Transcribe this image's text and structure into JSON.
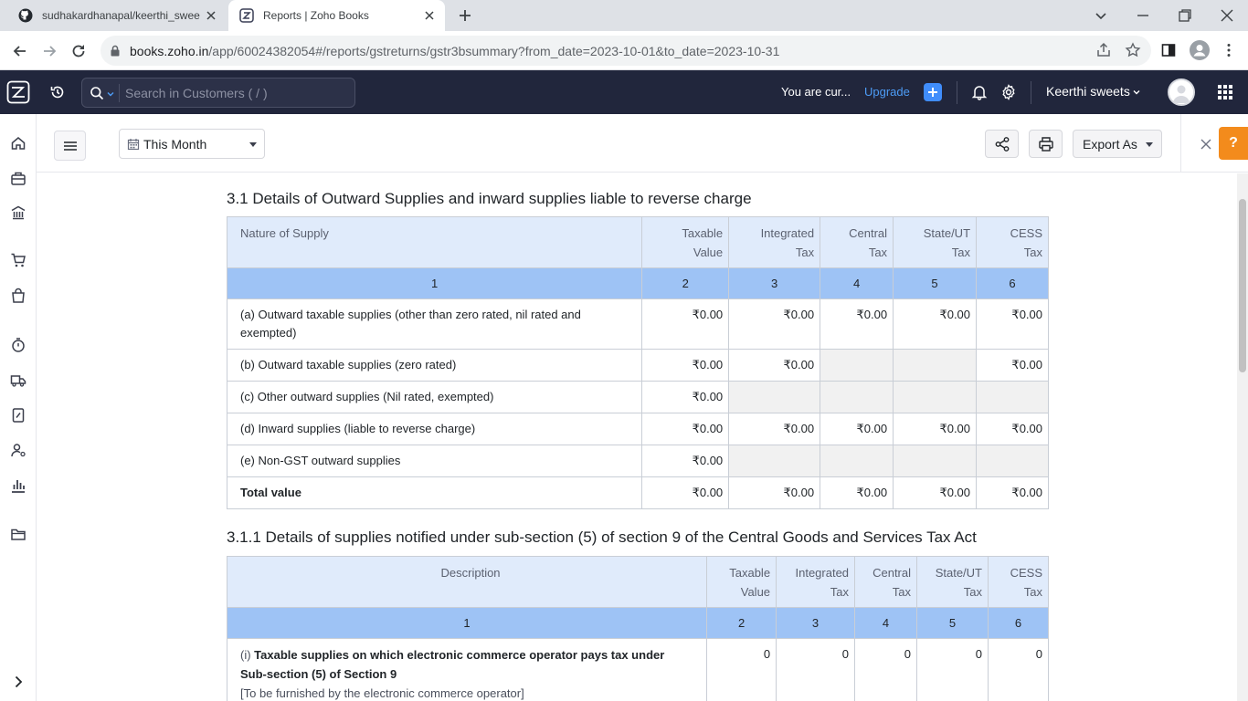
{
  "browser": {
    "tabs": [
      {
        "title": "sudhakardhanapal/keerthi_swee",
        "icon": "github-icon",
        "active": false
      },
      {
        "title": "Reports | Zoho Books",
        "icon": "zoho-books-icon",
        "active": true
      }
    ],
    "url_host": "books.zoho.in",
    "url_path": "/app/60024382054#/reports/gstreturns/gstr3bsummary?from_date=2023-10-01&to_date=2023-10-31"
  },
  "topbar": {
    "search_placeholder": "Search in Customers ( / )",
    "trial_text": "You are cur...",
    "upgrade_label": "Upgrade",
    "org_name": "Keerthi sweets"
  },
  "toolbar": {
    "period_label": "This Month",
    "export_label": "Export As",
    "help_label": "?"
  },
  "section1": {
    "title": "3.1 Details of Outward Supplies and inward supplies liable to reverse charge",
    "headers": [
      "Nature of Supply",
      "Taxable Value",
      "Integrated Tax",
      "Central Tax",
      "State/UT Tax",
      "CESS Tax"
    ],
    "header_lines": [
      [
        "Nature of Supply"
      ],
      [
        "Taxable",
        "Value"
      ],
      [
        "Integrated",
        "Tax"
      ],
      [
        "Central",
        "Tax"
      ],
      [
        "State/UT",
        "Tax"
      ],
      [
        "CESS",
        "Tax"
      ]
    ],
    "col_numbers": [
      "1",
      "2",
      "3",
      "4",
      "5",
      "6"
    ],
    "rows": [
      {
        "label": "(a) Outward taxable supplies (other than zero rated, nil rated and exempted)",
        "taxable": "₹0.00",
        "integrated": "₹0.00",
        "central": "₹0.00",
        "state": "₹0.00",
        "cess": "₹0.00"
      },
      {
        "label": "(b) Outward taxable supplies (zero rated)",
        "taxable": "₹0.00",
        "integrated": "₹0.00",
        "central": "",
        "state": "",
        "cess": "₹0.00"
      },
      {
        "label": "(c) Other outward supplies (Nil rated, exempted)",
        "taxable": "₹0.00",
        "integrated": "",
        "central": "",
        "state": "",
        "cess": ""
      },
      {
        "label": "(d) Inward supplies (liable to reverse charge)",
        "taxable": "₹0.00",
        "integrated": "₹0.00",
        "central": "₹0.00",
        "state": "₹0.00",
        "cess": "₹0.00"
      },
      {
        "label": "(e) Non-GST outward supplies",
        "taxable": "₹0.00",
        "integrated": "",
        "central": "",
        "state": "",
        "cess": ""
      }
    ],
    "total": {
      "label": "Total value",
      "taxable": "₹0.00",
      "integrated": "₹0.00",
      "central": "₹0.00",
      "state": "₹0.00",
      "cess": "₹0.00"
    }
  },
  "section2": {
    "title": "3.1.1 Details of supplies notified under sub-section (5) of section 9 of the Central Goods and Services Tax Act",
    "header_lines": [
      [
        "Description"
      ],
      [
        "Taxable",
        "Value"
      ],
      [
        "Integrated",
        "Tax"
      ],
      [
        "Central",
        "Tax"
      ],
      [
        "State/UT",
        "Tax"
      ],
      [
        "CESS",
        "Tax"
      ]
    ],
    "col_numbers": [
      "1",
      "2",
      "3",
      "4",
      "5",
      "6"
    ],
    "rows": [
      {
        "prefix": "(i) ",
        "label_bold": "Taxable supplies on which electronic commerce operator pays tax under Sub-section (5) of Section 9",
        "note": "[To be furnished by the electronic commerce operator]",
        "taxable": "0",
        "integrated": "0",
        "central": "0",
        "state": "0",
        "cess": "0"
      }
    ]
  }
}
